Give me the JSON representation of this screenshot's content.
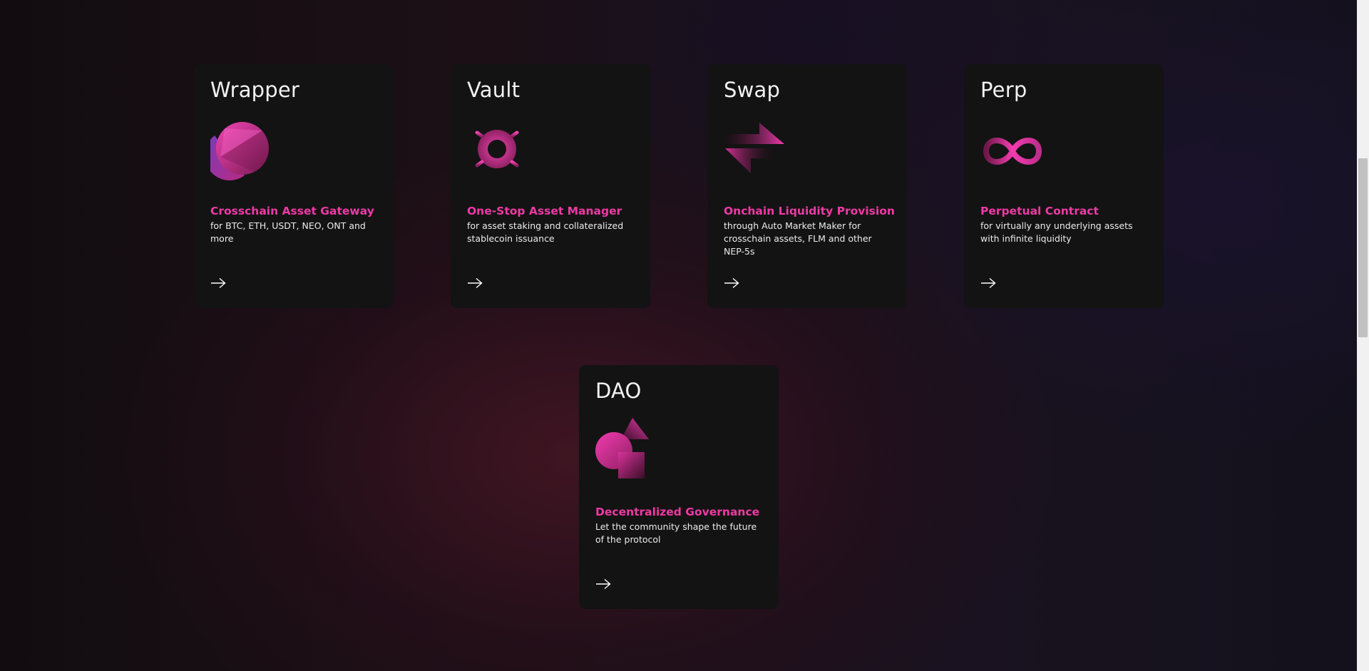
{
  "cards": [
    {
      "title": "Wrapper",
      "icon": "half-sphere-icon",
      "subtitle": "Crosschain Asset Gateway",
      "description": "for BTC, ETH, USDT, NEO, ONT and more",
      "arrow": "arrow-right-icon"
    },
    {
      "title": "Vault",
      "icon": "gear-sun-icon",
      "subtitle": "One-Stop Asset Manager",
      "description": "for asset staking and collateralized stablecoin issuance",
      "arrow": "arrow-right-icon"
    },
    {
      "title": "Swap",
      "icon": "swap-arrows-icon",
      "subtitle": "Onchain Liquidity Provision",
      "description": "through Auto Market Maker for crosschain assets, FLM and other NEP-5s",
      "arrow": "arrow-right-icon"
    },
    {
      "title": "Perp",
      "icon": "infinity-icon",
      "subtitle": "Perpetual Contract",
      "description": "for virtually any underlying assets with infinite liquidity",
      "arrow": "arrow-right-icon"
    },
    {
      "title": "DAO",
      "icon": "shapes-icon",
      "subtitle": "Decentralized Governance",
      "description": "Let the community shape the future of the protocol",
      "arrow": "arrow-right-icon"
    }
  ],
  "colors": {
    "accent": "#ee3aa5",
    "card_background": "#131313",
    "title_text": "#f2f2f2",
    "body_text": "#ececec"
  }
}
